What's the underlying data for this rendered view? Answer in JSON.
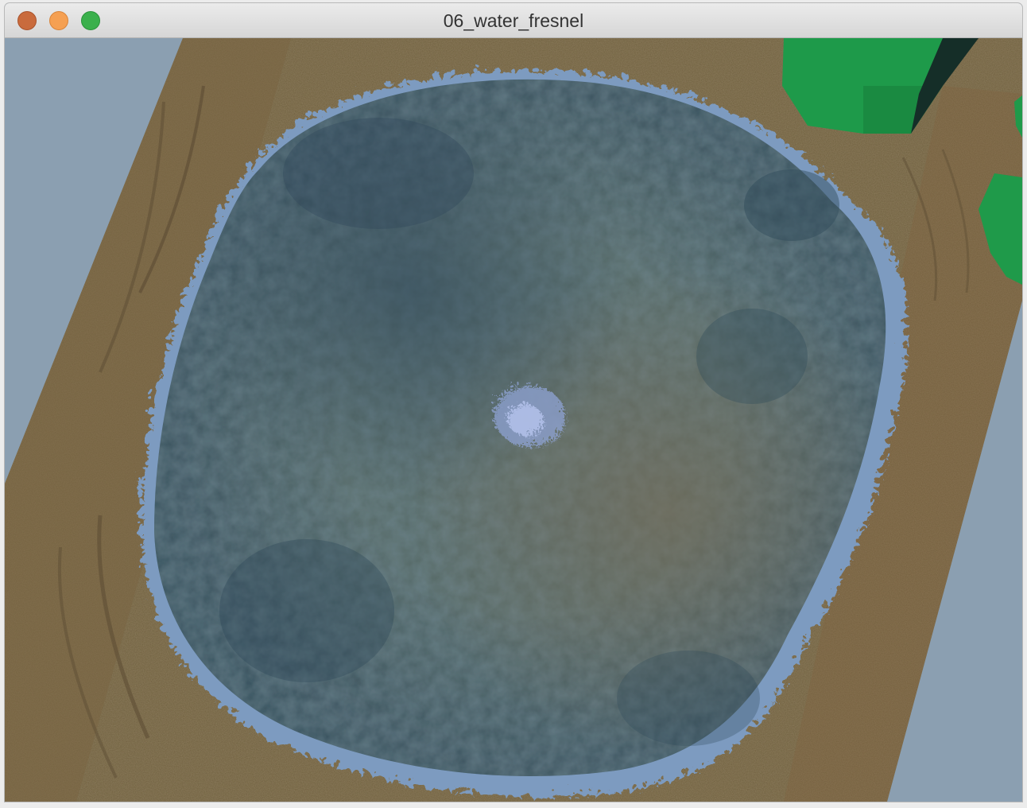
{
  "window": {
    "title": "06_water_fresnel",
    "controls": {
      "close": "close-window",
      "minimize": "minimize-window",
      "maximize": "zoom-window"
    }
  },
  "scene": {
    "sky_color": "#8b9fb1",
    "ground_color": "#6f5f3e",
    "water_color": "#4f6a6a",
    "foam_color": "#7e9cc0",
    "tree_color": "#1f9a4a"
  }
}
